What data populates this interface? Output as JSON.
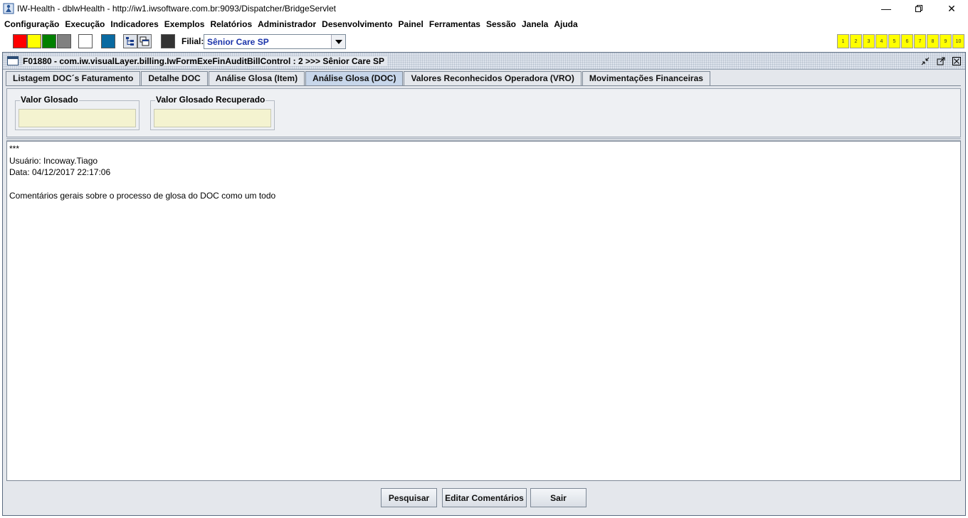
{
  "window": {
    "title": "IW-Health - dblwHealth - http://iw1.iwsoftware.com.br:9093/Dispatcher/BridgeServlet",
    "controls": [
      "minimize-icon",
      "restore-icon",
      "close-icon"
    ]
  },
  "menu": {
    "items": [
      "Configuração",
      "Execução",
      "Indicadores",
      "Exemplos",
      "Relatórios",
      "Administrador",
      "Desenvolvimento",
      "Painel",
      "Ferramentas",
      "Sessão",
      "Janela",
      "Ajuda"
    ]
  },
  "toolbar": {
    "color_swatches": [
      "#ff0000",
      "#ffff00",
      "#008000",
      "#808080",
      "#ffffff",
      "#0a6aa1",
      "#333333"
    ],
    "filial_label": "Filial:",
    "filial_value": "Sênior Care SP",
    "numbered_buttons": [
      "1",
      "2",
      "3",
      "4",
      "5",
      "6",
      "7",
      "8",
      "9",
      "10"
    ]
  },
  "frame": {
    "title": "F01880 - com.iw.visualLayer.billing.IwFormExeFinAuditBillControl : 2 >>> Sênior Care SP",
    "tabs": [
      {
        "label": "Listagem DOC´s Faturamento",
        "active": false
      },
      {
        "label": "Detalhe DOC",
        "active": false
      },
      {
        "label": "Análise Glosa (Item)",
        "active": false
      },
      {
        "label": "Análise Glosa (DOC)",
        "active": true
      },
      {
        "label": "Valores Reconhecidos Operadora (VRO)",
        "active": false
      },
      {
        "label": "Movimentações Financeiras",
        "active": false
      }
    ],
    "fields": {
      "valor_glosado": {
        "label": "Valor Glosado",
        "value": ""
      },
      "valor_glosado_recuperado": {
        "label": "Valor Glosado Recuperado",
        "value": ""
      }
    },
    "comments": {
      "line1": "***",
      "line2": "Usuário: Incoway.Tiago",
      "line3": "Data: 04/12/2017 22:17:06",
      "line4": "",
      "line5": "Comentários gerais sobre o processo de glosa do DOC como um todo"
    },
    "buttons": {
      "pesquisar": "Pesquisar",
      "editar": "Editar Comentários",
      "sair": "Sair"
    }
  }
}
